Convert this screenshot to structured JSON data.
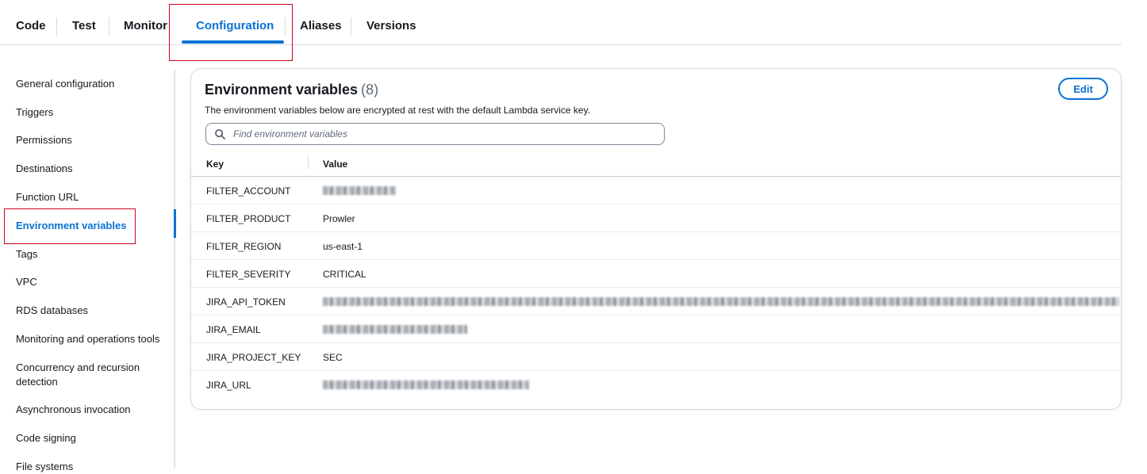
{
  "tabs": [
    {
      "label": "Code"
    },
    {
      "label": "Test"
    },
    {
      "label": "Monitor"
    },
    {
      "label": "Configuration",
      "active": true
    },
    {
      "label": "Aliases"
    },
    {
      "label": "Versions"
    }
  ],
  "sidebar": {
    "items": [
      {
        "label": "General configuration"
      },
      {
        "label": "Triggers"
      },
      {
        "label": "Permissions"
      },
      {
        "label": "Destinations"
      },
      {
        "label": "Function URL"
      },
      {
        "label": "Environment variables",
        "active": true
      },
      {
        "label": "Tags"
      },
      {
        "label": "VPC"
      },
      {
        "label": "RDS databases"
      },
      {
        "label": "Monitoring and operations tools"
      },
      {
        "label": "Concurrency and recursion detection"
      },
      {
        "label": "Asynchronous invocation"
      },
      {
        "label": "Code signing"
      },
      {
        "label": "File systems"
      }
    ]
  },
  "panel": {
    "title": "Environment variables",
    "count": "(8)",
    "description": "The environment variables below are encrypted at rest with the default Lambda service key.",
    "edit_label": "Edit",
    "search_placeholder": "Find environment variables",
    "columns": {
      "key": "Key",
      "value": "Value"
    },
    "rows": [
      {
        "key": "FILTER_ACCOUNT",
        "value": "",
        "redacted": true
      },
      {
        "key": "FILTER_PRODUCT",
        "value": "Prowler",
        "redacted": false
      },
      {
        "key": "FILTER_REGION",
        "value": "us-east-1",
        "redacted": false
      },
      {
        "key": "FILTER_SEVERITY",
        "value": "CRITICAL",
        "redacted": false
      },
      {
        "key": "JIRA_API_TOKEN",
        "value": "",
        "redacted": true
      },
      {
        "key": "JIRA_EMAIL",
        "value": "",
        "redacted": true
      },
      {
        "key": "JIRA_PROJECT_KEY",
        "value": "SEC",
        "redacted": false
      },
      {
        "key": "JIRA_URL",
        "value": "",
        "redacted": true
      }
    ]
  },
  "colors": {
    "accent": "#0972d3",
    "highlight": "#d0021b"
  }
}
